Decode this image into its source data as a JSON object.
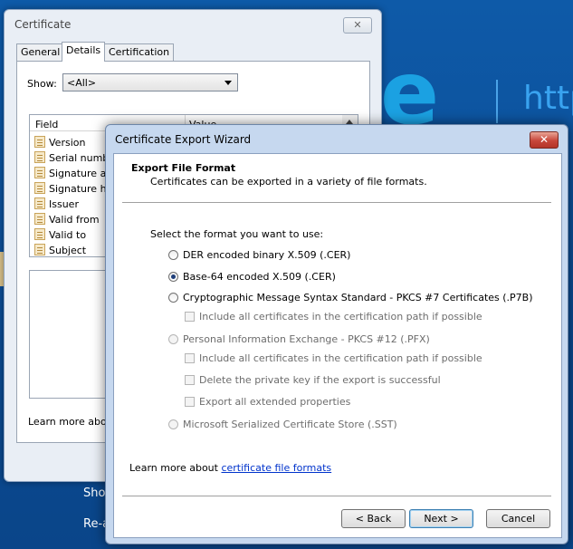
{
  "background": {
    "ie_url_fragment": "http",
    "bottom_texts": [
      "Show",
      "Re-a"
    ],
    "colors": {
      "desktop": "#0c4f99",
      "ie_blue": "#1ba1e2"
    }
  },
  "certificate_window": {
    "title": "Certificate",
    "close_glyph": "✕",
    "tabs": [
      "General",
      "Details",
      "Certification Path"
    ],
    "active_tab": "Details",
    "show_label": "Show:",
    "show_value": "<All>",
    "columns": {
      "field": "Field",
      "value": "Value"
    },
    "fields": [
      "Version",
      "Serial numbe",
      "Signature alg",
      "Signature ha",
      "Issuer",
      "Valid from",
      "Valid to",
      "Subject"
    ],
    "learn_more": "Learn more about"
  },
  "wizard": {
    "title": "Certificate Export Wizard",
    "close_glyph": "✕",
    "heading": "Export File Format",
    "subheading": "Certificates can be exported in a variety of file formats.",
    "select_label": "Select the format you want to use:",
    "options": {
      "der": "DER encoded binary X.509 (.CER)",
      "base64": "Base-64 encoded X.509 (.CER)",
      "pkcs7": "Cryptographic Message Syntax Standard - PKCS #7 Certificates (.P7B)",
      "pkcs7_include": "Include all certificates in the certification path if possible",
      "pfx": "Personal Information Exchange - PKCS #12 (.PFX)",
      "pfx_include": "Include all certificates in the certification path if possible",
      "pfx_delete": "Delete the private key if the export is successful",
      "pfx_export_props": "Export all extended properties",
      "sst": "Microsoft Serialized Certificate Store (.SST)"
    },
    "selected_option": "base64",
    "learn_more_prefix": "Learn more about",
    "learn_more_link": "certificate file formats",
    "buttons": {
      "back": "< Back",
      "next": "Next >",
      "cancel": "Cancel"
    }
  }
}
